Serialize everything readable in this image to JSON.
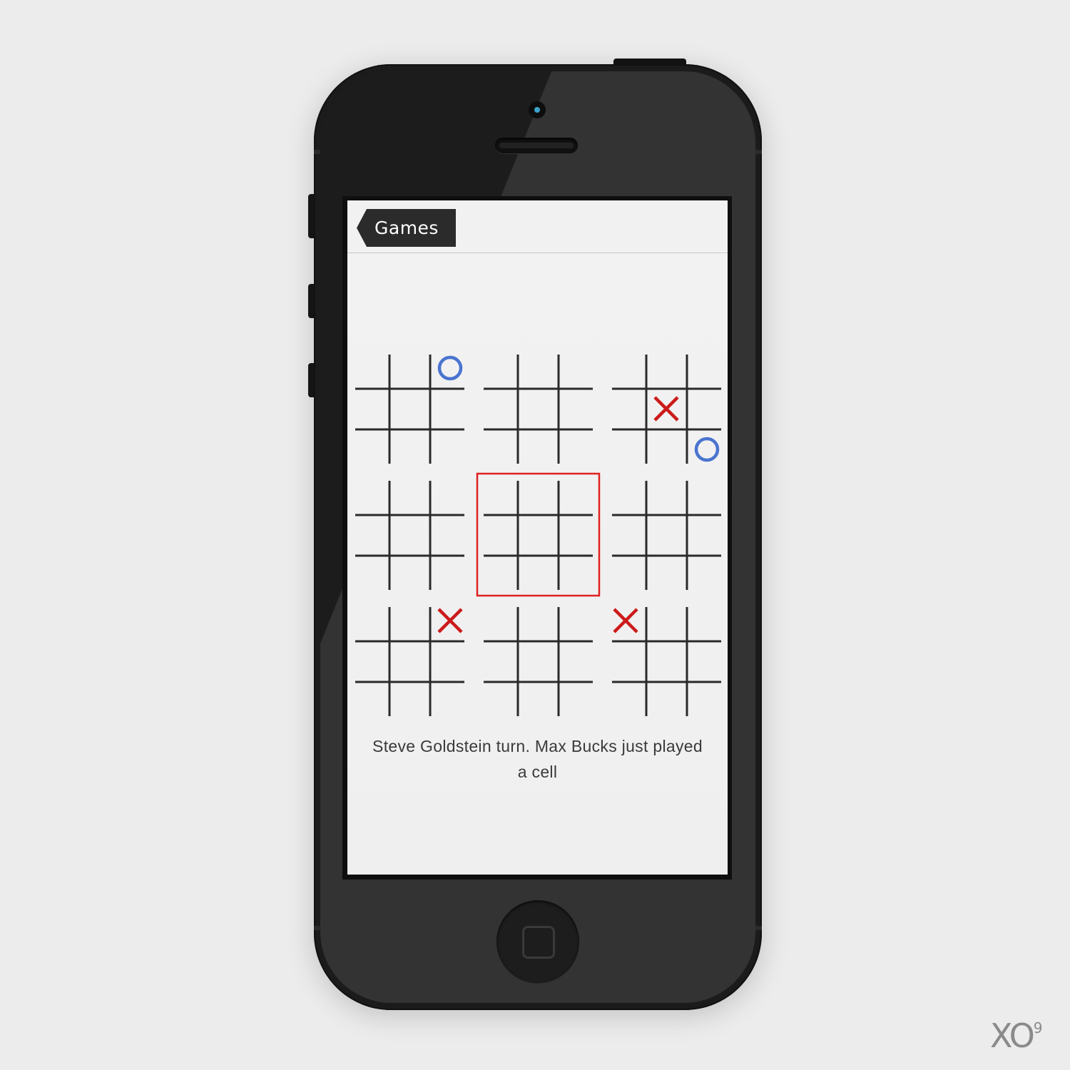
{
  "nav": {
    "back_label": "Games"
  },
  "status": {
    "line1": "Steve Goldstein turn. Max Bucks just played",
    "line2": "a cell"
  },
  "board": {
    "active_board": [
      1,
      1
    ],
    "highlight_color": "#e02020",
    "x_color": "#cc1a1a",
    "o_color": "#4a74d0",
    "grid_color": "#2a2a2a",
    "sub_boards": [
      [
        [
          "",
          "",
          "O"
        ],
        [
          "",
          "",
          ""
        ],
        [
          "",
          "",
          ""
        ]
      ],
      [
        [
          "",
          "",
          ""
        ],
        [
          "",
          "",
          ""
        ],
        [
          "",
          "",
          ""
        ]
      ],
      [
        [
          "",
          "",
          ""
        ],
        [
          "",
          "X",
          ""
        ],
        [
          "",
          "",
          "O"
        ]
      ],
      [
        [
          "",
          "",
          ""
        ],
        [
          "",
          "",
          ""
        ],
        [
          "",
          "",
          ""
        ]
      ],
      [
        [
          "",
          "",
          ""
        ],
        [
          "",
          "",
          ""
        ],
        [
          "",
          "",
          ""
        ]
      ],
      [
        [
          "",
          "",
          ""
        ],
        [
          "",
          "",
          ""
        ],
        [
          "",
          "",
          ""
        ]
      ],
      [
        [
          "",
          "",
          "X"
        ],
        [
          "",
          "",
          ""
        ],
        [
          "",
          "",
          ""
        ]
      ],
      [
        [
          "",
          "",
          ""
        ],
        [
          "",
          "",
          ""
        ],
        [
          "",
          "",
          ""
        ]
      ],
      [
        [
          "X",
          "",
          ""
        ],
        [
          "",
          "",
          ""
        ],
        [
          "",
          "",
          ""
        ]
      ]
    ]
  },
  "watermark": {
    "text": "XO",
    "superscript": "9"
  },
  "icons": {
    "back": "back-arrow-icon",
    "home": "home-button-icon"
  }
}
